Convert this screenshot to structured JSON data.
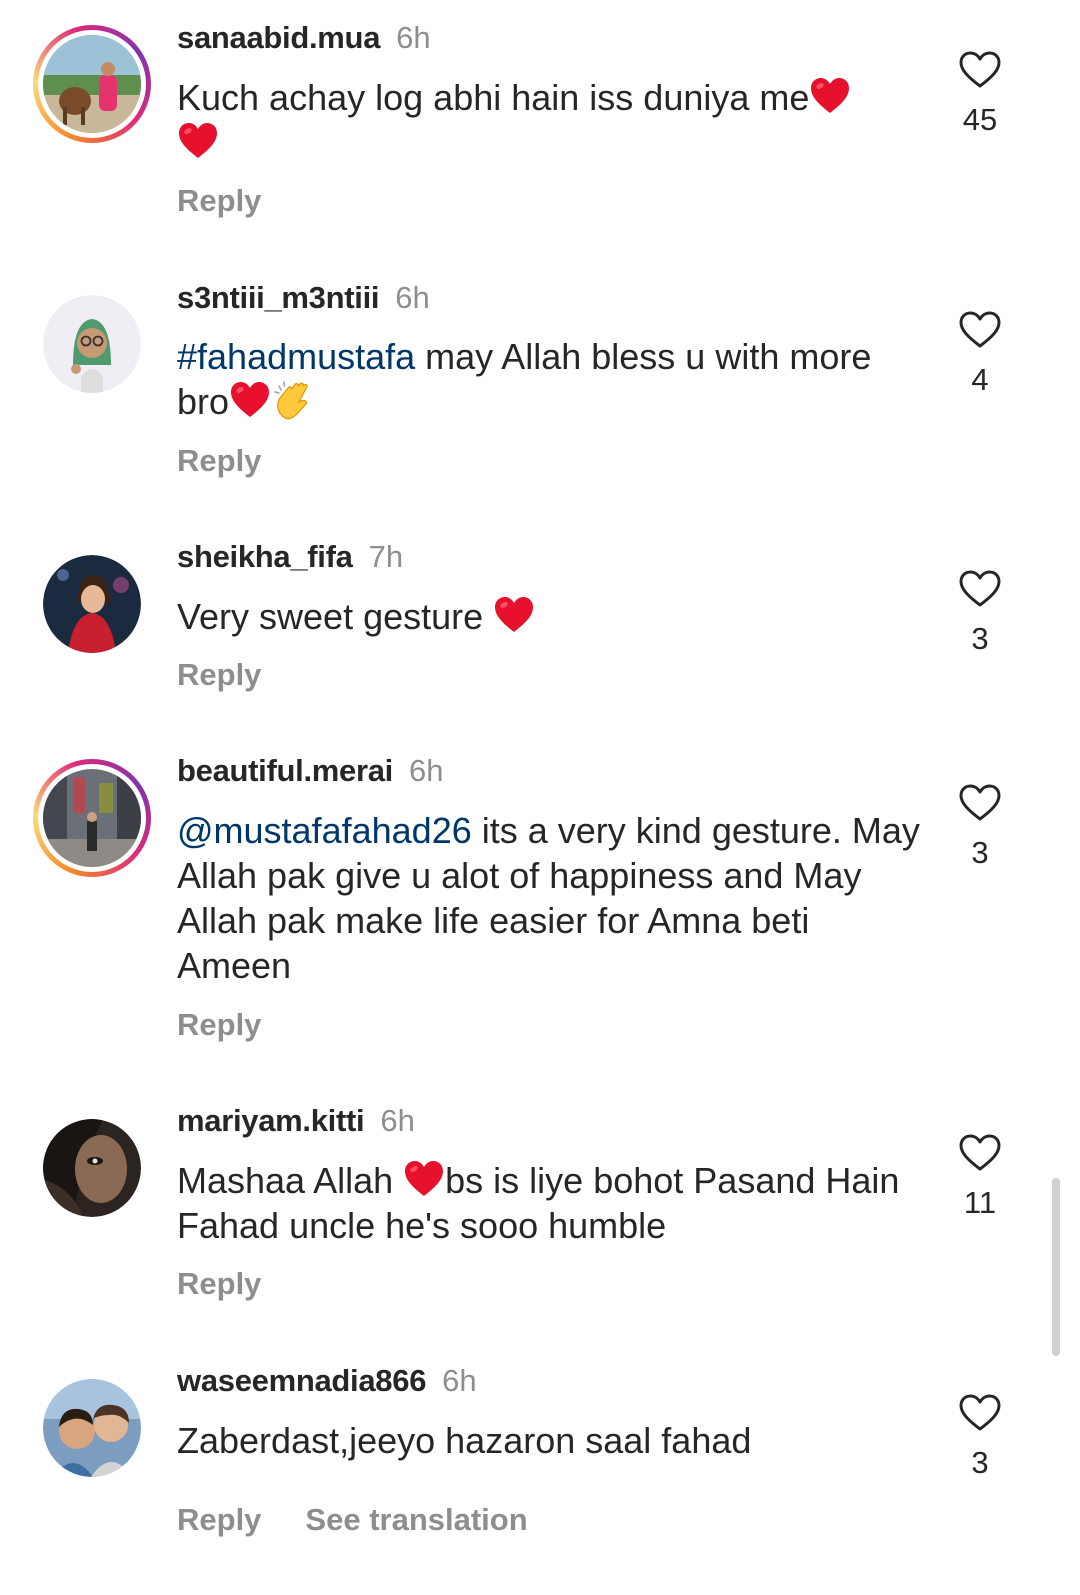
{
  "comments": [
    {
      "username": "sanaabid.mua",
      "time": "6h",
      "text_main": "Kuch achay log abhi hain iss duniya me",
      "likes": "45",
      "reply": "Reply"
    },
    {
      "username": "s3ntiii_m3ntiii",
      "time": "6h",
      "hashtag": "#fahadmustafa",
      "text_main": " may Allah bless u with more bro",
      "likes": "4",
      "reply": "Reply"
    },
    {
      "username": "sheikha_fifa",
      "time": "7h",
      "text_main": "Very sweet gesture ",
      "likes": "3",
      "reply": "Reply"
    },
    {
      "username": "beautiful.merai",
      "time": "6h",
      "mention": "@mustafafahad26",
      "text_main": " its a very kind gesture. May Allah pak give u alot of happiness and May Allah pak make life easier for Amna beti Ameen",
      "likes": "3",
      "reply": "Reply"
    },
    {
      "username": "mariyam.kitti",
      "time": "6h",
      "text_before": "Mashaa Allah ",
      "text_after": "bs is liye bohot Pasand Hain Fahad uncle he's sooo humble",
      "likes": "11",
      "reply": "Reply"
    },
    {
      "username": "waseemnadia866",
      "time": "6h",
      "text_main": "Zaberdast,jeeyo hazaron saal fahad",
      "likes": "3",
      "reply": "Reply",
      "see_translation": "See translation"
    }
  ],
  "colors": {
    "text": "#262626",
    "secondary": "#8e8e8e",
    "link": "#00376b",
    "heart_emoji": "#e8112d"
  },
  "icons": {
    "like": "heart-outline-icon",
    "emoji_heart": "red-heart-emoji",
    "emoji_clap": "clapping-hands-emoji"
  }
}
